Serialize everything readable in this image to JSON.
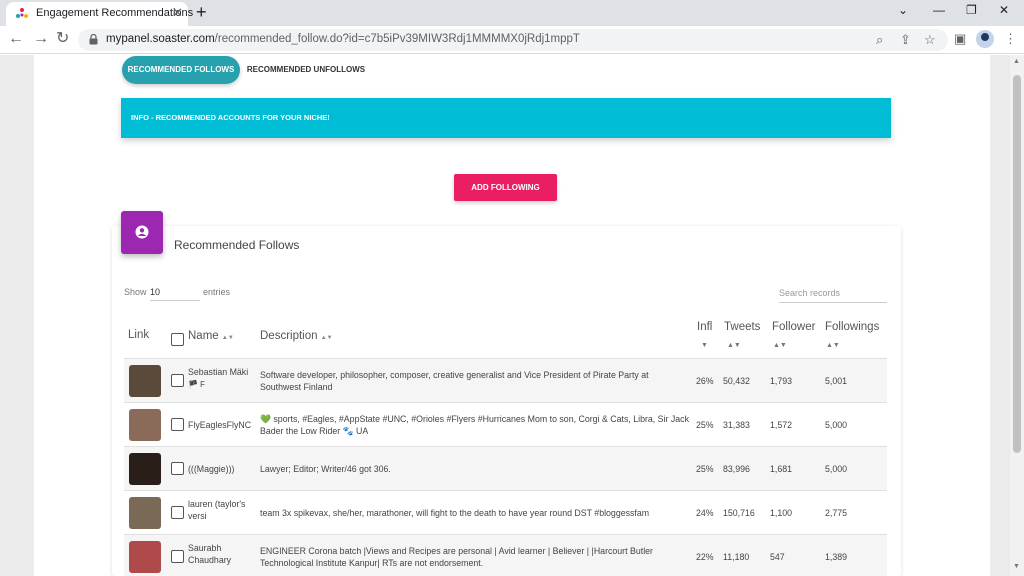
{
  "browser": {
    "tab_title": "Engagement Recommendations",
    "url_domain": "mypanel.soaster.com",
    "url_path": "/recommended_follow.do?id=c7b5iPv39MIW3Rdj1MMMMX0jRdj1mppT"
  },
  "tabs": {
    "active": "RECOMMENDED FOLLOWS",
    "inactive": "RECOMMENDED UNFOLLOWS"
  },
  "info_banner": "INFO - RECOMMENDED ACCOUNTS FOR YOUR NICHE!",
  "add_button": "ADD FOLLOWING",
  "card_title": "Recommended Follows",
  "table_controls": {
    "show_label": "Show",
    "entries_value": "10",
    "entries_label": "entries",
    "search_placeholder": "Search records"
  },
  "columns": {
    "link": "Link",
    "name": "Name",
    "description": "Description",
    "infl": "Infl",
    "tweets": "Tweets",
    "follower": "Follower",
    "followings": "Followings"
  },
  "rows": [
    {
      "name": "Sebastian Mäki",
      "name_extra": "🏴 F",
      "description": "Software developer, philosopher, composer, creative generalist and Vice President of Pirate Party at Southwest Finland",
      "infl": "26%",
      "tweets": "50,432",
      "follower": "1,793",
      "followings": "5,001",
      "avatar_color": "#5a4a3a"
    },
    {
      "name": "FlyEaglesFlyNC",
      "name_extra": "",
      "description": "💚 sports, #Eagles, #AppState #UNC, #Orioles #Flyers #Hurricanes Mom to son, Corgi & Cats, Libra, Sir Jack Bader the Low Rider 🐾 UA",
      "infl": "25%",
      "tweets": "31,383",
      "follower": "1,572",
      "followings": "5,000",
      "avatar_color": "#8a6b5a"
    },
    {
      "name": "(((Maggie)))",
      "name_extra": "",
      "description": "Lawyer; Editor; Writer/46 got 306.",
      "infl": "25%",
      "tweets": "83,996",
      "follower": "1,681",
      "followings": "5,000",
      "avatar_color": "#2a1f18"
    },
    {
      "name": "lauren (taylor's versi",
      "name_extra": "",
      "description": "team 3x spikevax, she/her, marathoner, will fight to the death to have year round DST #bloggessfam",
      "infl": "24%",
      "tweets": "150,716",
      "follower": "1,100",
      "followings": "2,775",
      "avatar_color": "#7a6a55"
    },
    {
      "name": "Saurabh Chaudhary",
      "name_extra": "",
      "description": "ENGINEER Corona batch |Views and Recipes are personal | Avid learner | Believer | |Harcourt Butler Technological Institute Kanpur| RTs are not endorsement.",
      "infl": "22%",
      "tweets": "11,180",
      "follower": "547",
      "followings": "1,389",
      "avatar_color": "#b04a4a"
    }
  ],
  "icons": {
    "favicon": "engagement-favicon",
    "card": "user-circle-icon"
  },
  "colors": {
    "teal": "#26a1ad",
    "cyan": "#00bcd4",
    "pink": "#e91e63",
    "purple": "#9c27b0"
  }
}
